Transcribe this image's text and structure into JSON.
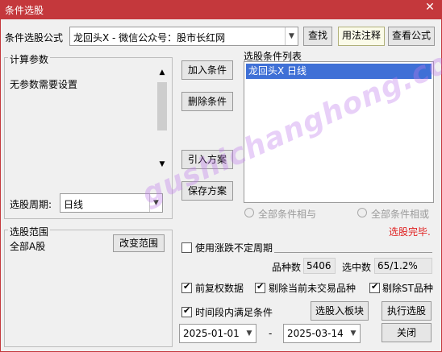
{
  "window": {
    "title": "条件选股",
    "close_glyph": "✕"
  },
  "formula": {
    "label": "条件选股公式",
    "value": "龙回头X  -  微信公众号：股市长红网",
    "find_btn": "查找",
    "usage_btn": "用法注释",
    "view_btn": "查看公式"
  },
  "params": {
    "group_title": "计算参数",
    "text": "无参数需要设置"
  },
  "period": {
    "label": "选股周期:",
    "value": "日线"
  },
  "buttons": {
    "add": "加入条件",
    "delete": "删除条件",
    "import": "引入方案",
    "save": "保存方案",
    "change_range": "改变范围",
    "to_board": "选股入板块",
    "execute": "执行选股",
    "close": "关闭"
  },
  "conditions": {
    "title": "选股条件列表",
    "items": [
      "龙回头X  日线"
    ],
    "radio_and": "全部条件相与",
    "radio_or": "全部条件相或"
  },
  "status": {
    "text": "选股完毕.",
    "color": "#e02020"
  },
  "range": {
    "group_title": "选股范围",
    "value": "全部A股"
  },
  "indefinite": {
    "label": "使用涨跌不定周期"
  },
  "stats": {
    "count_label": "品种数",
    "count_value": "5406",
    "selected_label": "选中数",
    "selected_value": "65/1.2%"
  },
  "options": {
    "pre_adjusted": "前复权数据",
    "exclude_suspended": "剔除当前未交易品种",
    "exclude_st": "剔除ST品种",
    "time_range": "时间段内满足条件"
  },
  "dates": {
    "start": "2025-01-01",
    "separator": "-",
    "end": "2025-03-14"
  },
  "watermark": "gushichanghong.com"
}
